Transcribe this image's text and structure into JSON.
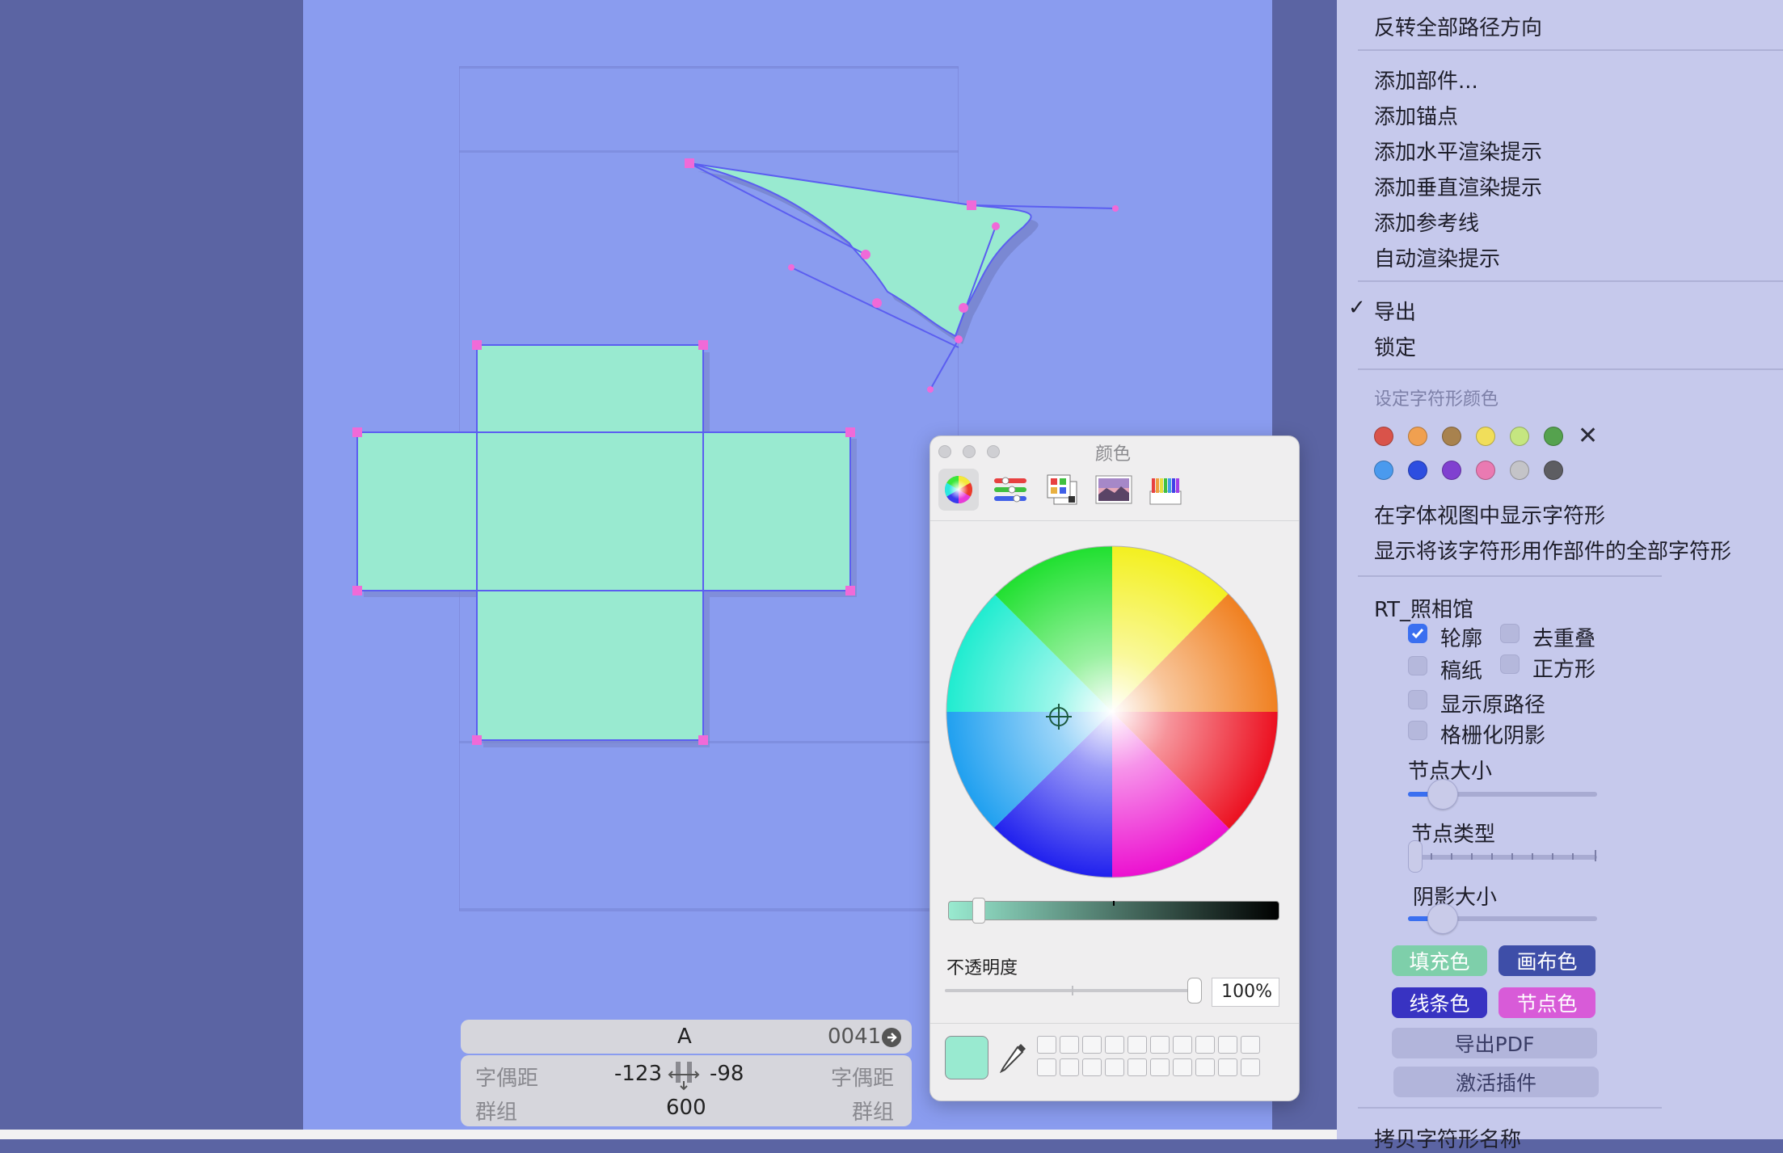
{
  "info_panel": {
    "glyph_name": "A",
    "unicode": "0041",
    "left_kerning_label": "字偶距",
    "right_kerning_label": "字偶距",
    "left_kerning_value": "-123",
    "right_kerning_value": "-98",
    "width_value": "600",
    "left_group_label": "群组",
    "right_group_label": "群组"
  },
  "color_panel": {
    "title": "颜色",
    "opacity_label": "不透明度",
    "opacity_value": "100%",
    "current_color": "#99ead0",
    "brightness_fraction": 0.9,
    "opacity_fraction": 1.0
  },
  "context_menu": {
    "items_top": [
      "反转全部路径方向"
    ],
    "items_add": [
      "添加部件...",
      "添加锚点",
      "添加水平渲染提示",
      "添加垂直渲染提示",
      "添加参考线",
      "自动渲染提示"
    ],
    "export_label": "导出",
    "export_checked": true,
    "lock_label": "锁定",
    "color_header": "设定字符形颜色",
    "swatch_colors_row1": [
      "#d9534a",
      "#f0a050",
      "#a8824e",
      "#f1de5a",
      "#c5e680",
      "#55a24e"
    ],
    "swatch_colors_row2": [
      "#4a9aee",
      "#2d4ee0",
      "#8040d0",
      "#ea7ab2",
      "#c4c4c8",
      "#5d5d62"
    ],
    "show_in_font_view": "在字体视图中显示字符形",
    "show_all_using_component": "显示将该字符形用作部件的全部字符形",
    "plugin_name": "RT_照相馆",
    "checkboxes": [
      {
        "label": "轮廓",
        "checked": true
      },
      {
        "label": "去重叠",
        "checked": false
      },
      {
        "label": "稿纸",
        "checked": false
      },
      {
        "label": "正方形",
        "checked": false
      },
      {
        "label": "显示原路径",
        "checked": false
      },
      {
        "label": "格栅化阴影",
        "checked": false
      }
    ],
    "slider_node_size_label": "节点大小",
    "slider_node_size_value": 0.17,
    "slider_node_type_label": "节点类型",
    "slider_node_type_value": 0.0,
    "slider_shadow_size_label": "阴影大小",
    "slider_shadow_size_value": 0.17,
    "fill_color_label": "填充色",
    "canvas_color_label": "画布色",
    "line_color_label": "线条色",
    "node_color_label": "节点色",
    "export_pdf_label": "导出PDF",
    "activate_plugin_label": "激活插件",
    "copy_glyph_name_label": "拷贝字符形名称",
    "fill_color": "#7ecfaa",
    "canvas_color": "#3e4ea8",
    "line_color": "#3833c2",
    "node_color": "#d85bd8"
  },
  "colors": {
    "background": "#5b64a3",
    "canvas": "#8a9cef",
    "shape_fill": "#99ead0",
    "outline": "#5b5ef0",
    "node": "#f06ad8"
  }
}
